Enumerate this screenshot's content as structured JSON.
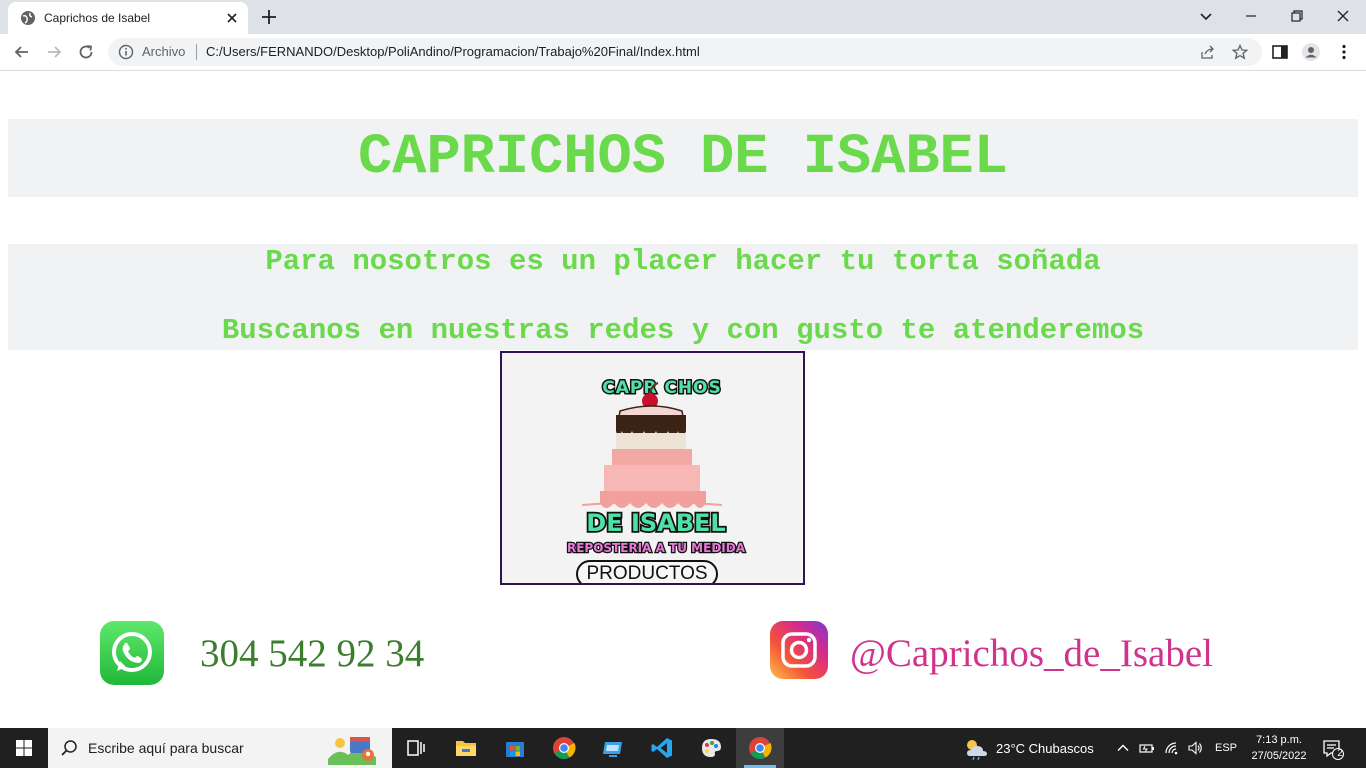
{
  "browser": {
    "tab_title": "Caprichos de Isabel",
    "origin_label": "Archivo",
    "url": "C:/Users/FERNANDO/Desktop/PoliAndino/Programacion/Trabajo%20Final/Index.html"
  },
  "page": {
    "title": "CAPRICHOS DE ISABEL",
    "tagline_1": "Para nosotros es un placer hacer tu torta soñada",
    "tagline_2": "Buscanos en nuestras redes y con gusto te atenderemos",
    "logo": {
      "brand_top": "CAPR CHOS",
      "brand_bottom": "DE ISABEL",
      "slogan": "REPOSTERIA A TU MEDIDA"
    },
    "products_button": "PRODUCTOS",
    "phone": "304 542 92 34",
    "instagram_handle": "@Caprichos_de_Isabel",
    "colors": {
      "title_green": "#6ad94c",
      "phone_green": "#3c7d2e",
      "handle_pink": "#d0338c",
      "box_gray": "#f0f2f3"
    }
  },
  "taskbar": {
    "search_placeholder": "Escribe aquí para buscar",
    "weather": "23°C  Chubascos",
    "language": "ESP",
    "time": "7:13 p.m.",
    "date": "27/05/2022",
    "notification_count": "2",
    "apps": [
      "task-view",
      "file-explorer",
      "microsoft-store",
      "chrome",
      "screen-app",
      "vscode",
      "paint",
      "chrome-active"
    ]
  }
}
